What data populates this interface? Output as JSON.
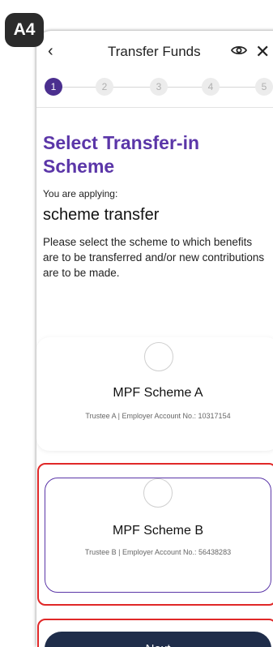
{
  "badge": "A4",
  "header": {
    "title": "Transfer Funds",
    "back_icon": "chevron-left-icon",
    "eye_icon": "eye-icon",
    "close_icon": "close-icon"
  },
  "stepper": {
    "steps": [
      "1",
      "2",
      "3",
      "4",
      "5"
    ],
    "active_step": 1
  },
  "main": {
    "heading": "Select Transfer-in Scheme",
    "applying_label": "You are applying:",
    "applying_value": "scheme transfer",
    "instruction": "Please select the scheme to which benefits are to be transferred and/or new contributions are to be made."
  },
  "schemes": [
    {
      "name": "MPF Scheme A",
      "trustee": "Trustee A",
      "account_label": "| Employer Account No.:",
      "account_no": "10317154"
    },
    {
      "name": "MPF Scheme B",
      "trustee": "Trustee B",
      "account_label": "| Employer Account No.:",
      "account_no": "56438283"
    }
  ],
  "actions": {
    "next_label": "Next"
  },
  "colors": {
    "accent": "#5b36a8",
    "active_step": "#4b2f8f",
    "button": "#1f2d4a",
    "highlight": "#e02828"
  }
}
